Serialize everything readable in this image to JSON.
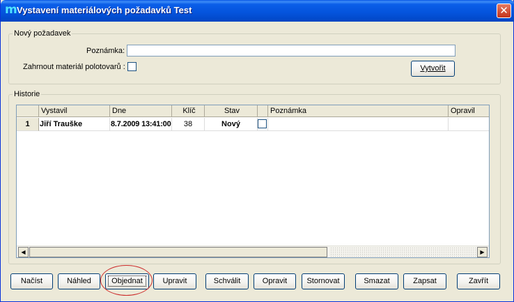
{
  "window": {
    "title": "Vystavení materiálových požadavků Test",
    "app_icon_glyph": "m",
    "close_glyph": "✕"
  },
  "new_request": {
    "legend": "Nový požadavek",
    "note_label": "Poznámka:",
    "note_value": "",
    "include_label": "Zahrnout materiál polotovarů :",
    "include_checked": false,
    "create_button": "Vytvořit"
  },
  "history": {
    "legend": "Historie",
    "columns": [
      "",
      "Vystavil",
      "Dne",
      "Klíč",
      "Stav",
      "",
      "Poznámka",
      "Opravil"
    ],
    "rows": [
      {
        "num": "1",
        "issued_by": "Jiří Trauške",
        "date": "8.7.2009 13:41:00",
        "key": "38",
        "state": "Nový",
        "checked": false,
        "note": "",
        "fixed_by": ""
      }
    ],
    "scroll_left": "◀",
    "scroll_right": "▶"
  },
  "buttons": {
    "load": "Načíst",
    "preview": "Náhled",
    "order": "Objednat",
    "edit": "Upravit",
    "approve": "Schválit",
    "fix": "Opravit",
    "cancel": "Stornovat",
    "delete": "Smazat",
    "write": "Zapsat",
    "close": "Zavřít"
  },
  "colors": {
    "titlebar": "#0453dc",
    "dialog_bg": "#ece9d8",
    "annotation": "#cc2a2a"
  },
  "icons": {
    "app": "app-logo-icon",
    "close": "close-icon"
  }
}
